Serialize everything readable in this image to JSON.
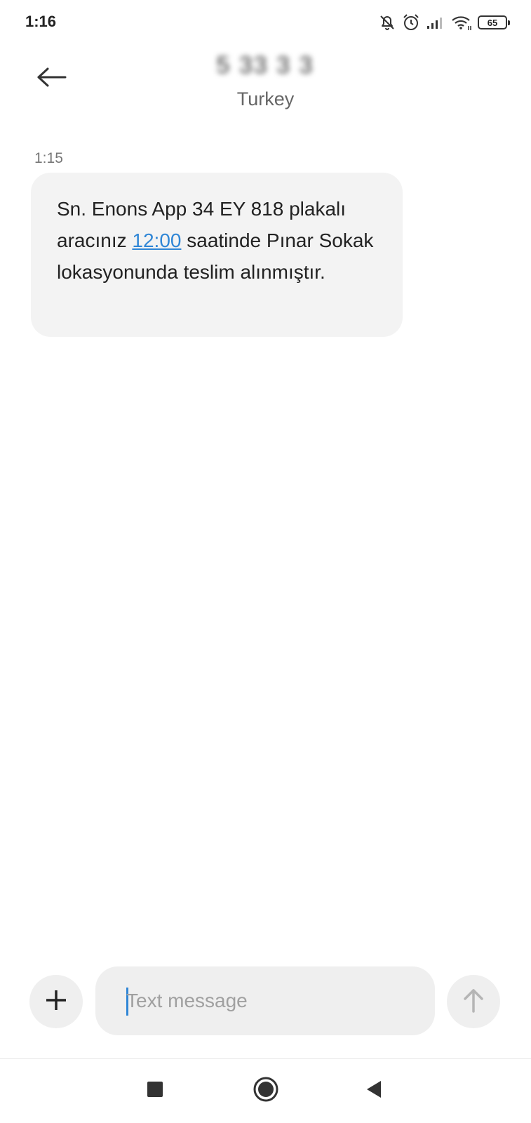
{
  "status_bar": {
    "time": "1:16",
    "battery_level": "65",
    "icons": [
      "notifications-off-icon",
      "alarm-icon",
      "signal-icon",
      "wifi-icon",
      "battery-icon"
    ]
  },
  "header": {
    "contact_number": "5 33 3 3",
    "contact_subtitle": "Turkey",
    "back_icon": "arrow-left-icon"
  },
  "conversation": {
    "messages": [
      {
        "time": "1:15",
        "text_before_link": "Sn. Enons App 34 EY 818 plakalı aracınız ",
        "link_text": "12:00",
        "text_after_link": " saatinde Pınar Sokak lokasyonunda teslim alınmıştır."
      }
    ]
  },
  "composer": {
    "input_placeholder": "Text message",
    "input_value": "",
    "add_icon": "plus-icon",
    "send_icon": "arrow-up-icon"
  },
  "navigation": {
    "recent_icon": "square-icon",
    "home_icon": "circle-icon",
    "back_icon": "triangle-back-icon"
  },
  "colors": {
    "accent": "#2f86d6",
    "bubble": "#f3f3f3",
    "field": "#efefef"
  }
}
